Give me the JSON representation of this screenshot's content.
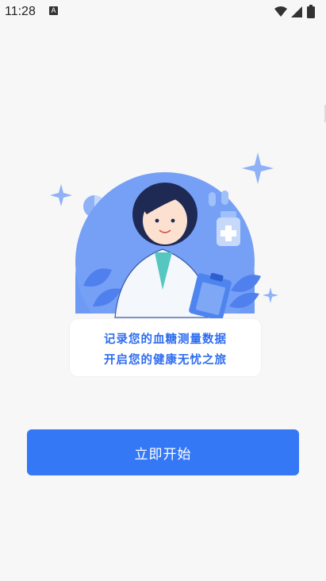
{
  "status": {
    "time": "11:28",
    "notification_icon": "A"
  },
  "card": {
    "line1": "记录您的血糖测量数据",
    "line2": "开启您的健康无忧之旅"
  },
  "start_button": {
    "label": "立即开始"
  },
  "colors": {
    "primary": "#3478f6",
    "card_text": "#2d6cf0",
    "illustration_blue": "#5f8ff4"
  }
}
